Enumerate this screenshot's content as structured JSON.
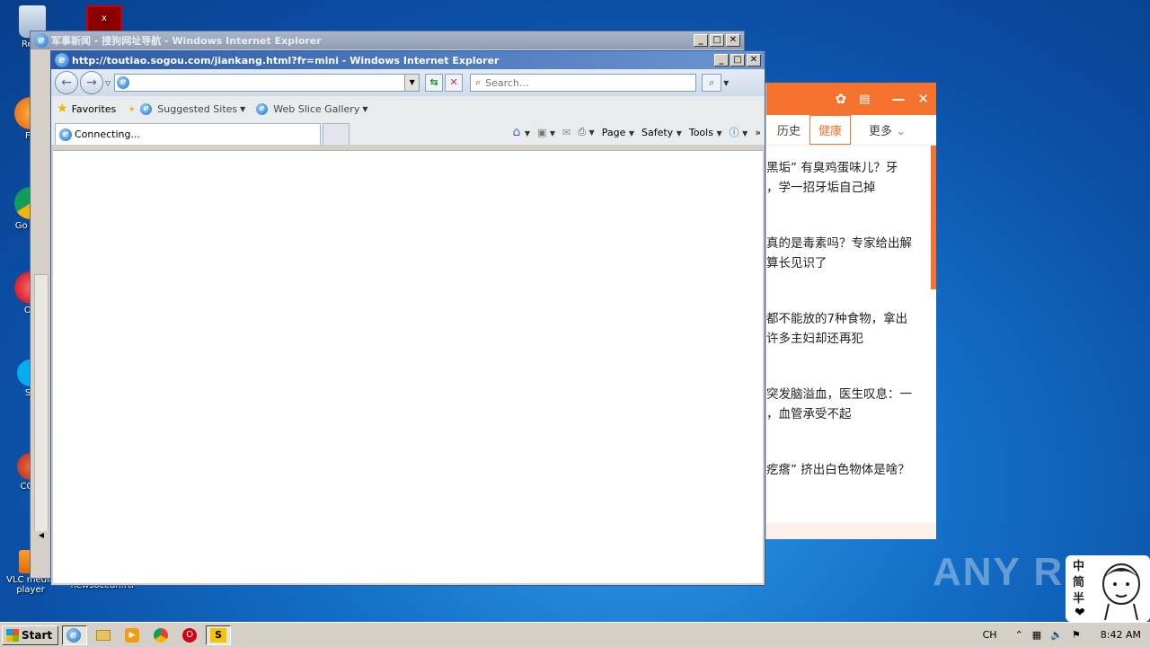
{
  "desktop": {
    "icons": [
      {
        "label": "Recy"
      },
      {
        "label": "Fir"
      },
      {
        "label": "Go Chr"
      },
      {
        "label": "Op"
      },
      {
        "label": "Sk"
      },
      {
        "label": "CCle"
      },
      {
        "label": "VLC media player"
      },
      {
        "label": "newsocean.rtf"
      }
    ],
    "watermark": "ANY RUN"
  },
  "back_window": {
    "title": "军事新闻 - 搜狗网址导航 - Windows Internet Explorer"
  },
  "front_window": {
    "title": "http://toutiao.sogou.com/jiankang.html?fr=mini - Windows Internet Explorer",
    "address_value": "",
    "search_placeholder": "Search...",
    "favorites_label": "Favorites",
    "suggested_sites_label": "Suggested Sites",
    "web_slice_label": "Web Slice Gallery",
    "tab_label": "Connecting...",
    "commands": {
      "page": "Page",
      "safety": "Safety",
      "tools": "Tools"
    }
  },
  "news_panel": {
    "tabs": [
      "历史",
      "健康",
      "更多"
    ],
    "active_tab": "健康",
    "articles": [
      {
        "line1": "黑垢” 有臭鸡蛋味儿？牙",
        "line2": "，学一招牙垢自己掉"
      },
      {
        "line1": "真的是毒素吗？专家给出解",
        "line2": "算长见识了"
      },
      {
        "line1": "都不能放的7种食物，拿出",
        "line2": "许多主妇却还再犯"
      },
      {
        "line1": "突发脑溢血，医生叹息：一",
        "line2": "，血管承受不起"
      },
      {
        "line1": "疙瘩” 挤出白色物体是啥？",
        "line2": ""
      }
    ],
    "accent": "#f5732f"
  },
  "sticker": {
    "text": "中简半"
  },
  "taskbar": {
    "start_label": "Start",
    "lang": "CH",
    "clock": "8:42 AM"
  }
}
